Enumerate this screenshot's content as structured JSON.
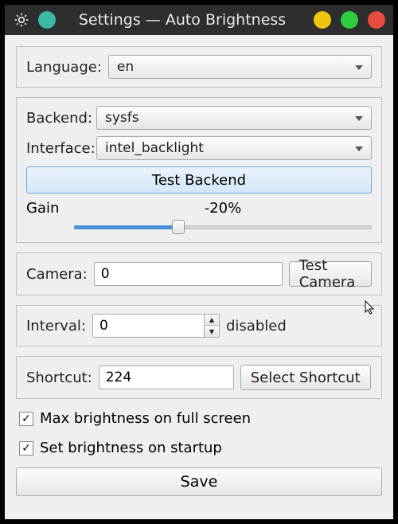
{
  "window": {
    "title": "Settings — Auto Brightness"
  },
  "language": {
    "label": "Language:",
    "value": "en"
  },
  "backend": {
    "label": "Backend:",
    "value": "sysfs",
    "interface_label": "Interface:",
    "interface_value": "intel_backlight",
    "test_label": "Test Backend",
    "gain_label": "Gain",
    "gain_value": "-20%",
    "gain_percent": 35
  },
  "camera": {
    "label": "Camera:",
    "value": "0",
    "test_label": "Test Camera"
  },
  "interval": {
    "label": "Interval:",
    "value": "0",
    "status": "disabled"
  },
  "shortcut": {
    "label": "Shortcut:",
    "value": "224",
    "button": "Select Shortcut"
  },
  "checks": {
    "max_fullscreen": "Max brightness on full screen",
    "on_startup": "Set brightness on startup"
  },
  "save": "Save"
}
